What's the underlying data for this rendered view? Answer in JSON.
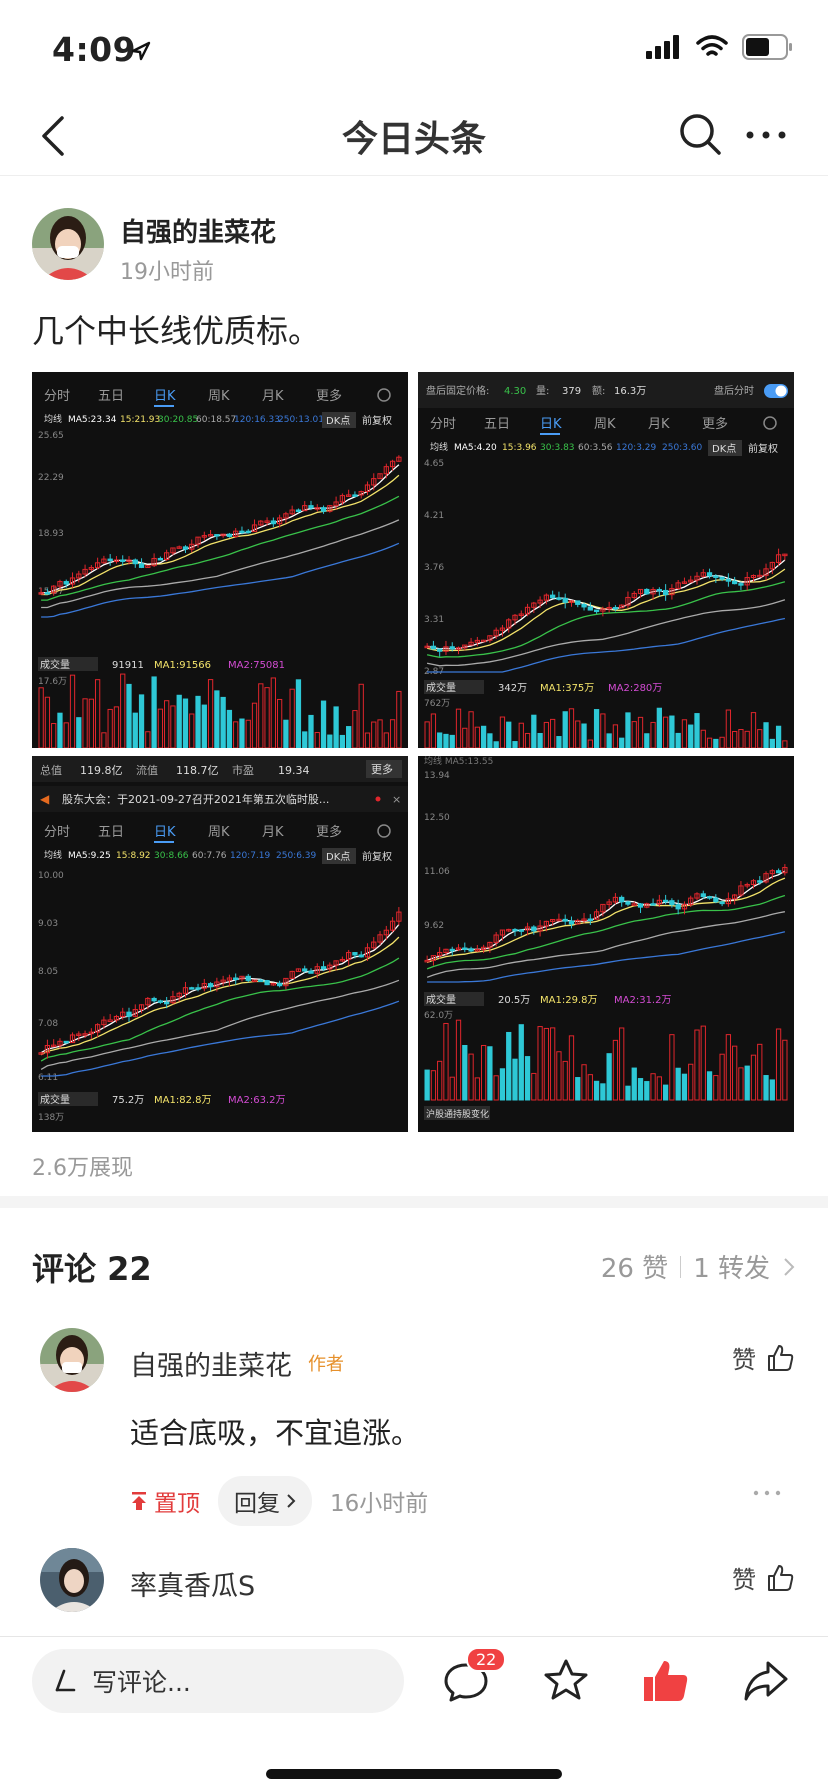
{
  "status": {
    "time": "4:09"
  },
  "nav": {
    "title": "今日头条"
  },
  "post": {
    "author": "自强的韭菜花",
    "time": "19小时前",
    "text": "几个中长线优质标。",
    "views": "2.6万展现"
  },
  "charts": {
    "tabs": [
      "分时",
      "五日",
      "日K",
      "周K",
      "月K",
      "更多"
    ],
    "dk_label": "DK点",
    "fq_label": "前复权",
    "ma_label": "均线",
    "vol_label": "成交量",
    "c1": {
      "ma": [
        "MA5:23.34",
        "15:21.93",
        "30:20.85",
        "60:18.57",
        "120:16.33",
        "250:13.01"
      ],
      "yticks": [
        "25.65",
        "22.29",
        "18.93",
        "15.57"
      ],
      "vol": [
        "91911",
        "MA1:91566",
        "MA2:75081"
      ],
      "vol_max": "17.6万"
    },
    "c2": {
      "top": [
        "盘后固定价格:",
        "4.30",
        "量:",
        "379",
        "额:",
        "16.3万",
        "盘后分时"
      ],
      "ma": [
        "MA5:4.20",
        "15:3.96",
        "30:3.83",
        "60:3.56",
        "120:3.29",
        "250:3.60"
      ],
      "yticks": [
        "4.65",
        "4.21",
        "3.76",
        "3.31",
        "2.87"
      ],
      "vol": [
        "342万",
        "MA1:375万",
        "MA2:280万"
      ],
      "vol_max": "762万"
    },
    "c3": {
      "top": [
        "总值",
        "119.8亿",
        "流值",
        "118.7亿",
        "市盈",
        "19.34",
        "更多"
      ],
      "notice": "股东大会：于2021-09-27召开2021年第五次临时股...",
      "ma": [
        "MA5:9.25",
        "15:8.92",
        "30:8.66",
        "60:7.76",
        "120:7.19",
        "250:6.39"
      ],
      "yticks": [
        "10.00",
        "9.03",
        "8.05",
        "7.08",
        "6.11"
      ],
      "vol": [
        "75.2万",
        "MA1:82.8万",
        "MA2:63.2万"
      ],
      "vol_max": "138万"
    },
    "c4": {
      "top_left": "均线 MA5:13.55",
      "yticks": [
        "13.94",
        "12.50",
        "11.06",
        "9.62"
      ],
      "vol": [
        "20.5万",
        "MA1:29.8万",
        "MA2:31.2万"
      ],
      "vol_max": "62.0万",
      "footer": "沪股通持股变化"
    }
  },
  "comments": {
    "title": "评论 22",
    "likes": "26 赞",
    "shares": "1 转发",
    "items": [
      {
        "name": "自强的韭菜花",
        "tag": "作者",
        "like": "赞",
        "text": "适合底吸，不宜追涨。",
        "pin": "置顶",
        "reply": "回复",
        "time": "16小时前"
      },
      {
        "name": "率真香瓜S",
        "like": "赞"
      }
    ]
  },
  "bottom": {
    "write_placeholder": "写评论...",
    "comment_count": "22"
  },
  "colors": {
    "red": "#e23b3b",
    "candle_up": "#e0262c",
    "candle_down": "#2ec8d6",
    "ma5": "#ffffff",
    "ma15": "#f3e36a",
    "ma30": "#39c24a",
    "ma60": "#aaaaaa",
    "ma120": "#3a78d8"
  }
}
